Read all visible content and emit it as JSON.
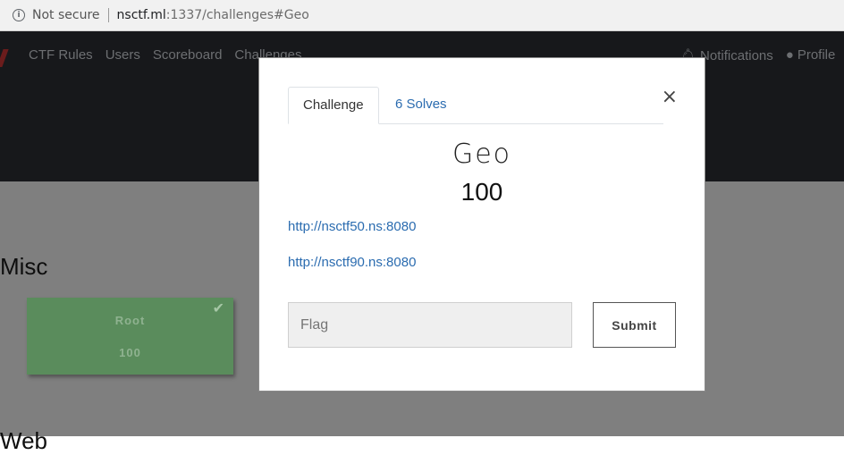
{
  "browser": {
    "security_label": "Not secure",
    "url_domain": "nsctf.ml",
    "url_path": ":1337/challenges#Geo"
  },
  "navbar": {
    "links": [
      "CTF Rules",
      "Users",
      "Scoreboard",
      "Challenges"
    ],
    "notifications_label": "Notifications",
    "profile_label": "Profile"
  },
  "categories": {
    "misc_label": "Misc",
    "web_label": "Web"
  },
  "challenge_card": {
    "name": "Root",
    "value": "100",
    "solved": true,
    "background_color": "#5a8c5c"
  },
  "modal": {
    "tabs": [
      "Challenge",
      "6 Solves"
    ],
    "active_tab": "Challenge",
    "close_label": "×",
    "title": "Geo",
    "value": "100",
    "links": [
      "http://nsctf50.ns:8080",
      "http://nsctf90.ns:8080"
    ],
    "flag_placeholder": "Flag",
    "flag_value": "",
    "submit_label": "Submit"
  },
  "colors": {
    "link": "#2b6cb0",
    "navbar_background": "#17181b",
    "overlay_background": "#7f7f7f"
  }
}
